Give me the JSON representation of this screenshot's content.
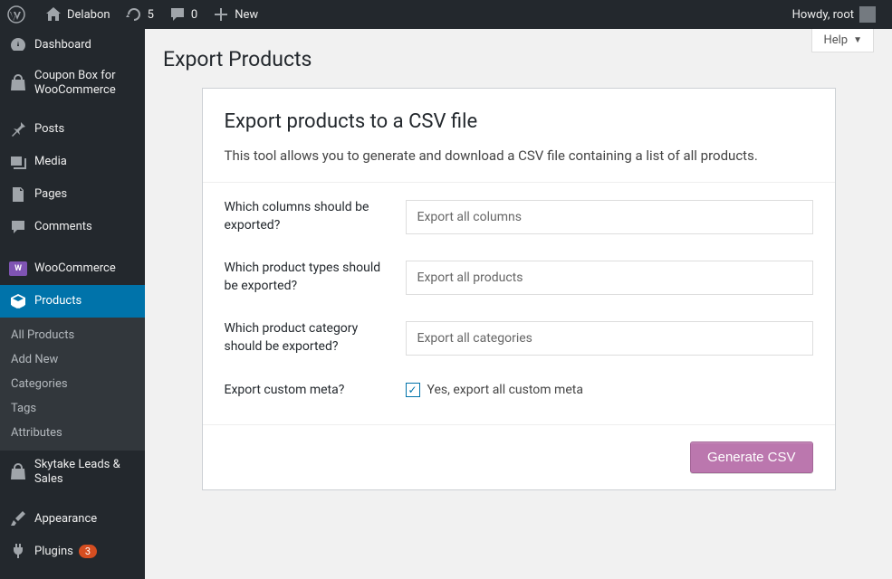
{
  "adminbar": {
    "site_name": "Delabon",
    "updates_count": "5",
    "comments_count": "0",
    "new_label": "New",
    "greeting": "Howdy, root"
  },
  "sidebar": {
    "dashboard": "Dashboard",
    "coupon_box": "Coupon Box for WooCommerce",
    "posts": "Posts",
    "media": "Media",
    "pages": "Pages",
    "comments": "Comments",
    "woocommerce": "WooCommerce",
    "products": "Products",
    "products_sub": {
      "all": "All Products",
      "add": "Add New",
      "categories": "Categories",
      "tags": "Tags",
      "attributes": "Attributes"
    },
    "skytake": "Skytake Leads & Sales",
    "appearance": "Appearance",
    "plugins": "Plugins",
    "plugins_badge": "3"
  },
  "page": {
    "help": "Help",
    "title": "Export Products"
  },
  "box": {
    "heading": "Export products to a CSV file",
    "description": "This tool allows you to generate and download a CSV file containing a list of all products.",
    "rows": {
      "columns_label": "Which columns should be exported?",
      "columns_placeholder": "Export all columns",
      "types_label": "Which product types should be exported?",
      "types_placeholder": "Export all products",
      "category_label": "Which product category should be exported?",
      "category_placeholder": "Export all categories",
      "meta_label": "Export custom meta?",
      "meta_checkbox": "Yes, export all custom meta"
    },
    "button": "Generate CSV"
  }
}
